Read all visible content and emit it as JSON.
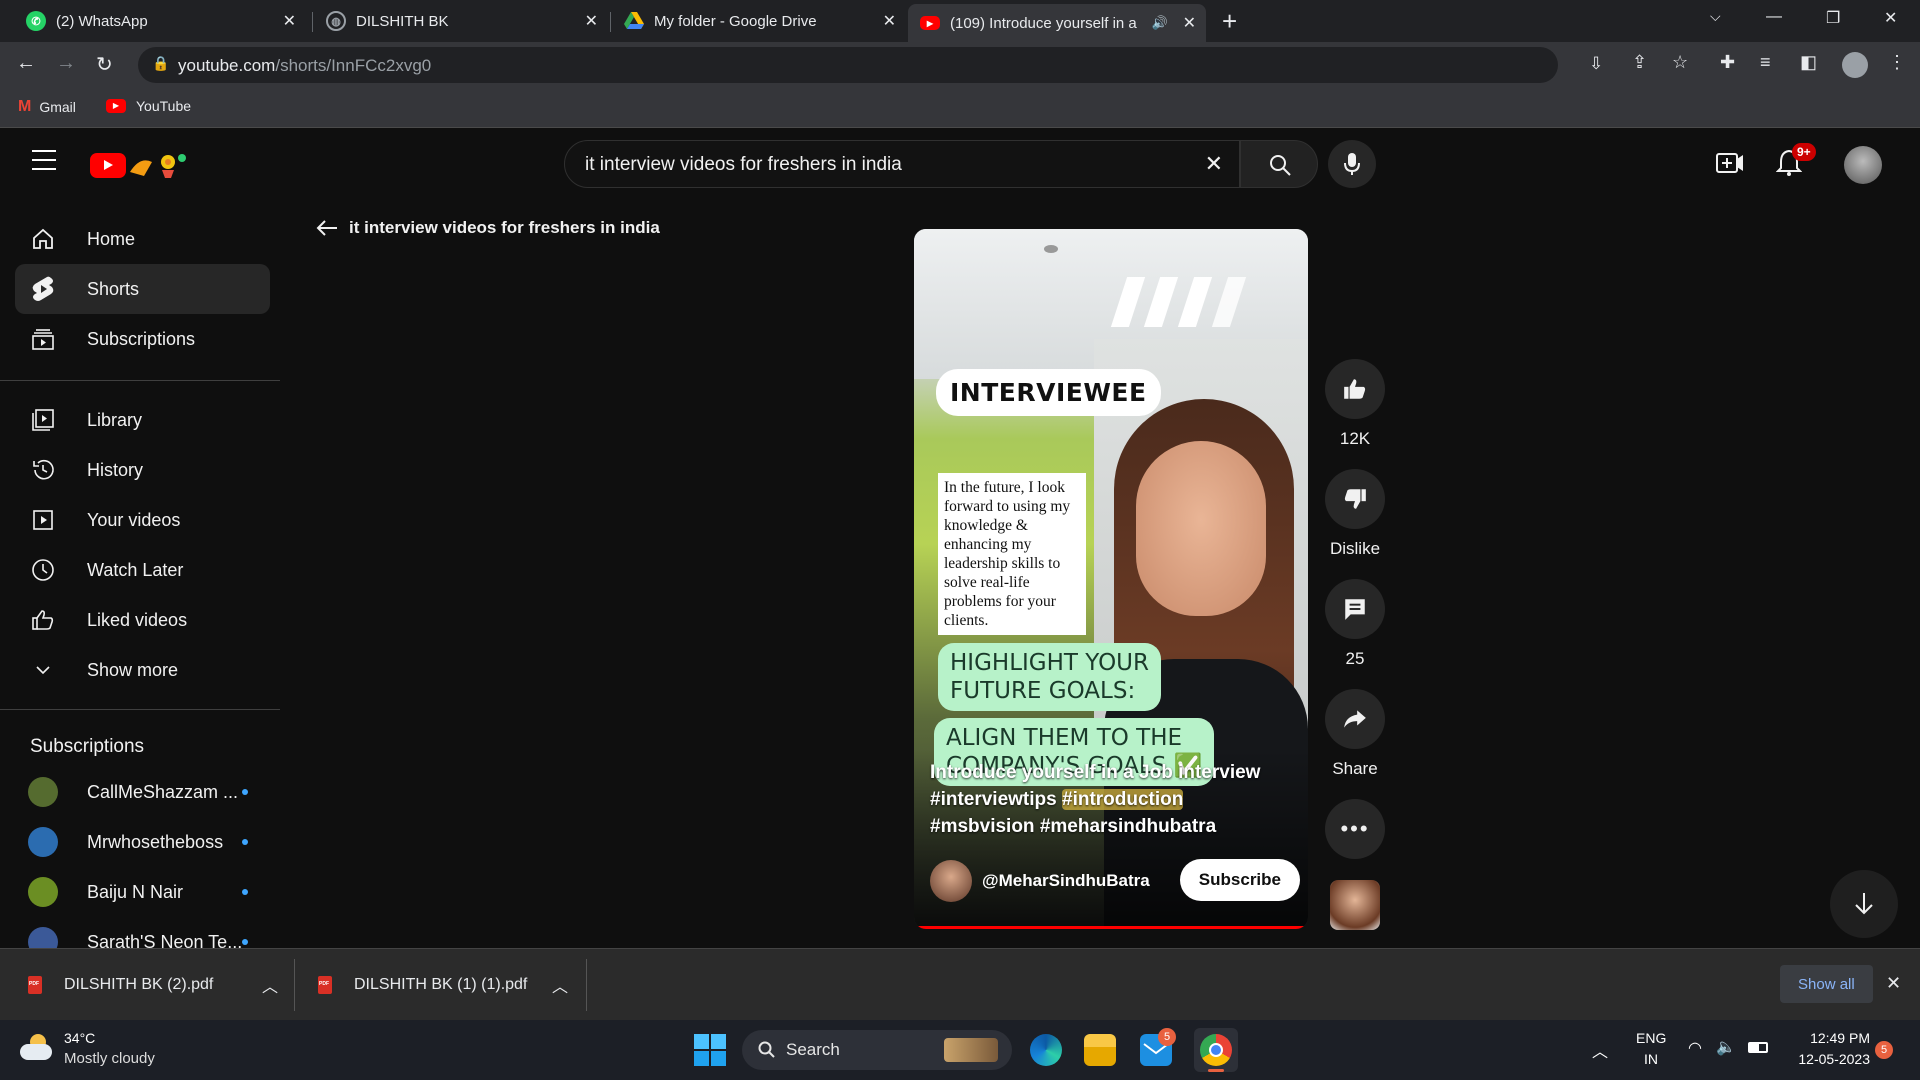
{
  "browser": {
    "tabs": [
      {
        "title": "(2) WhatsApp",
        "icon": "whatsapp-icon",
        "color": "#25d366"
      },
      {
        "title": "DILSHITH BK",
        "icon": "globe-icon",
        "color": "#9aa0a6"
      },
      {
        "title": "My folder - Google Drive",
        "icon": "google-drive-icon",
        "color": "#fbbc04"
      },
      {
        "title": "(109) Introduce yourself in a",
        "icon": "youtube-icon",
        "color": "#ff0000",
        "active": true
      }
    ],
    "url_host": "youtube.com",
    "url_path": "/shorts/InnFCc2xvg0",
    "bookmarks": [
      {
        "label": "Gmail",
        "icon": "gmail-icon"
      },
      {
        "label": "YouTube",
        "icon": "youtube-icon"
      }
    ]
  },
  "youtube": {
    "search_value": "it interview videos for freshers in india",
    "notification_badge": "9+",
    "back_title": "it interview videos for freshers in india",
    "sidebar": {
      "main": [
        {
          "label": "Home",
          "icon": "home-icon"
        },
        {
          "label": "Shorts",
          "icon": "shorts-icon",
          "active": true
        },
        {
          "label": "Subscriptions",
          "icon": "subscriptions-icon"
        }
      ],
      "library": [
        {
          "label": "Library",
          "icon": "library-icon"
        },
        {
          "label": "History",
          "icon": "history-icon"
        },
        {
          "label": "Your videos",
          "icon": "your-videos-icon"
        },
        {
          "label": "Watch Later",
          "icon": "clock-icon"
        },
        {
          "label": "Liked videos",
          "icon": "thumbs-up-icon"
        },
        {
          "label": "Show more",
          "icon": "chevron-down-icon"
        }
      ],
      "subscriptions_heading": "Subscriptions",
      "subscriptions": [
        {
          "label": "CallMeShazzam ...",
          "color": "#556b2f"
        },
        {
          "label": "Mrwhosetheboss",
          "color": "#2b6cb0"
        },
        {
          "label": "Baiju N Nair",
          "color": "#6b8e23"
        },
        {
          "label": "Sarath'S Neon Te...",
          "color": "#3b5998"
        }
      ]
    },
    "short": {
      "overlay_label": "INTERVIEWEE",
      "quote": "In the future, I look forward to using my knowledge & enhancing my leadership skills to solve real-life problems for your clients.",
      "tag1_line1": "HIGHLIGHT YOUR",
      "tag1_line2": "FUTURE GOALS:",
      "tag2_line1": "ALIGN THEM TO THE",
      "tag2_line2": "COMPANY'S GOALS ✅",
      "caption_line1": "Introduce yourself in a Job interview",
      "caption_tag1": "#interviewtips",
      "caption_tag2": "#introduction",
      "caption_line3": "#msbvision #meharsindhubatra",
      "channel": "@MeharSindhuBatra",
      "subscribe": "Subscribe"
    },
    "actions": {
      "likes": "12K",
      "dislike": "Dislike",
      "comments": "25",
      "share": "Share"
    }
  },
  "downloads": {
    "items": [
      "DILSHITH BK (2).pdf",
      "DILSHITH BK (1) (1).pdf"
    ],
    "show_all": "Show all"
  },
  "taskbar": {
    "temperature": "34°C",
    "weather": "Mostly cloudy",
    "search": "Search",
    "mail_badge": "5",
    "lang_line1": "ENG",
    "lang_line2": "IN",
    "time": "12:49 PM",
    "date": "12-05-2023",
    "notif_badge": "5"
  }
}
